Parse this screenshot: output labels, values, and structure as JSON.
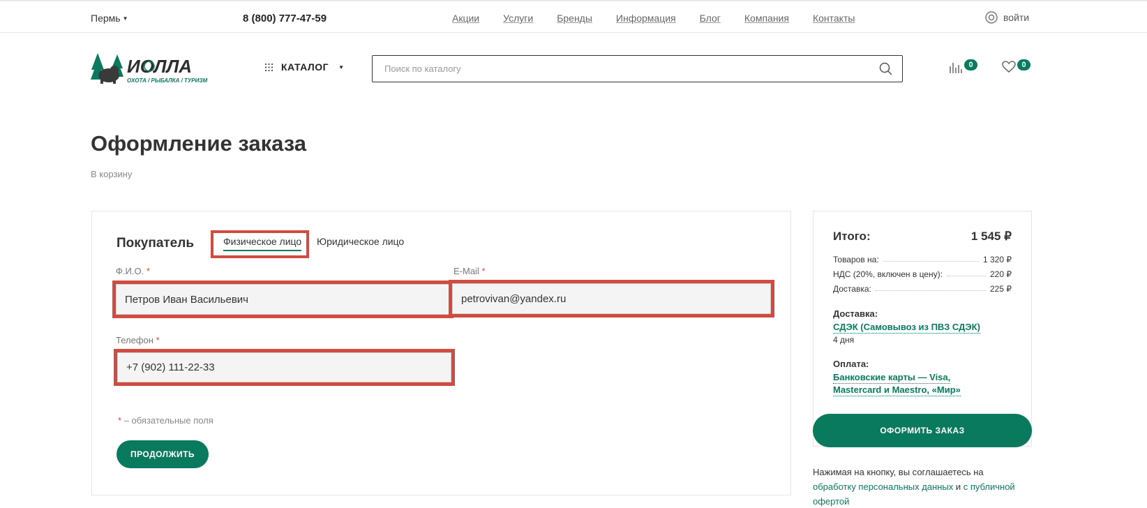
{
  "topbar": {
    "city": "Пермь",
    "phone": "8 (800) 777-47-59",
    "nav": [
      "Акции",
      "Услуги",
      "Бренды",
      "Информация",
      "Блог",
      "Компания",
      "Контакты"
    ],
    "login": "войти"
  },
  "header": {
    "logo_name": "ИОЛЛА",
    "logo_tagline": "ОХОТА / РЫБАЛКА / ТУРИЗМ",
    "catalog_label": "КАТАЛОГ",
    "search_placeholder": "Поиск по каталогу",
    "compare_count": "0",
    "favorites_count": "0"
  },
  "page": {
    "title": "Оформление заказа",
    "back_link": "В корзину"
  },
  "buyer": {
    "title": "Покупатель",
    "tabs": [
      "Физическое лицо",
      "Юридическое лицо"
    ],
    "fields": {
      "name": {
        "label": "Ф.И.О.",
        "required": "*",
        "value": "Петров Иван Васильевич"
      },
      "email": {
        "label": "E-Mail",
        "required": "*",
        "value": "petrovivan@yandex.ru"
      },
      "phone": {
        "label": "Телефон",
        "required": "*",
        "value": "+7 (902) 111-22-33"
      }
    },
    "required_star": "*",
    "required_note": "– обязательные поля",
    "continue_label": "ПРОДОЛЖИТЬ"
  },
  "summary": {
    "total_label": "Итого:",
    "total_value": "1 545 ₽",
    "rows": [
      {
        "label": "Товаров на:",
        "value": "1 320 ₽"
      },
      {
        "label": "НДС (20%, включен в цену):",
        "value": "220 ₽"
      },
      {
        "label": "Доставка:",
        "value": "225 ₽"
      }
    ],
    "delivery_label": "Доставка:",
    "delivery_method": "СДЭК (Самовывоз из ПВЗ СДЭК)",
    "delivery_time": "4 дня",
    "payment_label": "Оплата:",
    "payment_line1": "Банковские карты — Visa,",
    "payment_line2": "Mastercard и Maestro, «Мир»",
    "order_button": "ОФОРМИТЬ ЗАКАЗ",
    "agree_text": "Нажимая на кнопку, вы соглашаетесь на",
    "agree_link1": "обработку персональных данных",
    "agree_and": " и ",
    "agree_link2": "с публичной",
    "agree_link3": "офертой"
  },
  "colors": {
    "accent": "#0a7a5f",
    "highlight": "#d24b41"
  }
}
